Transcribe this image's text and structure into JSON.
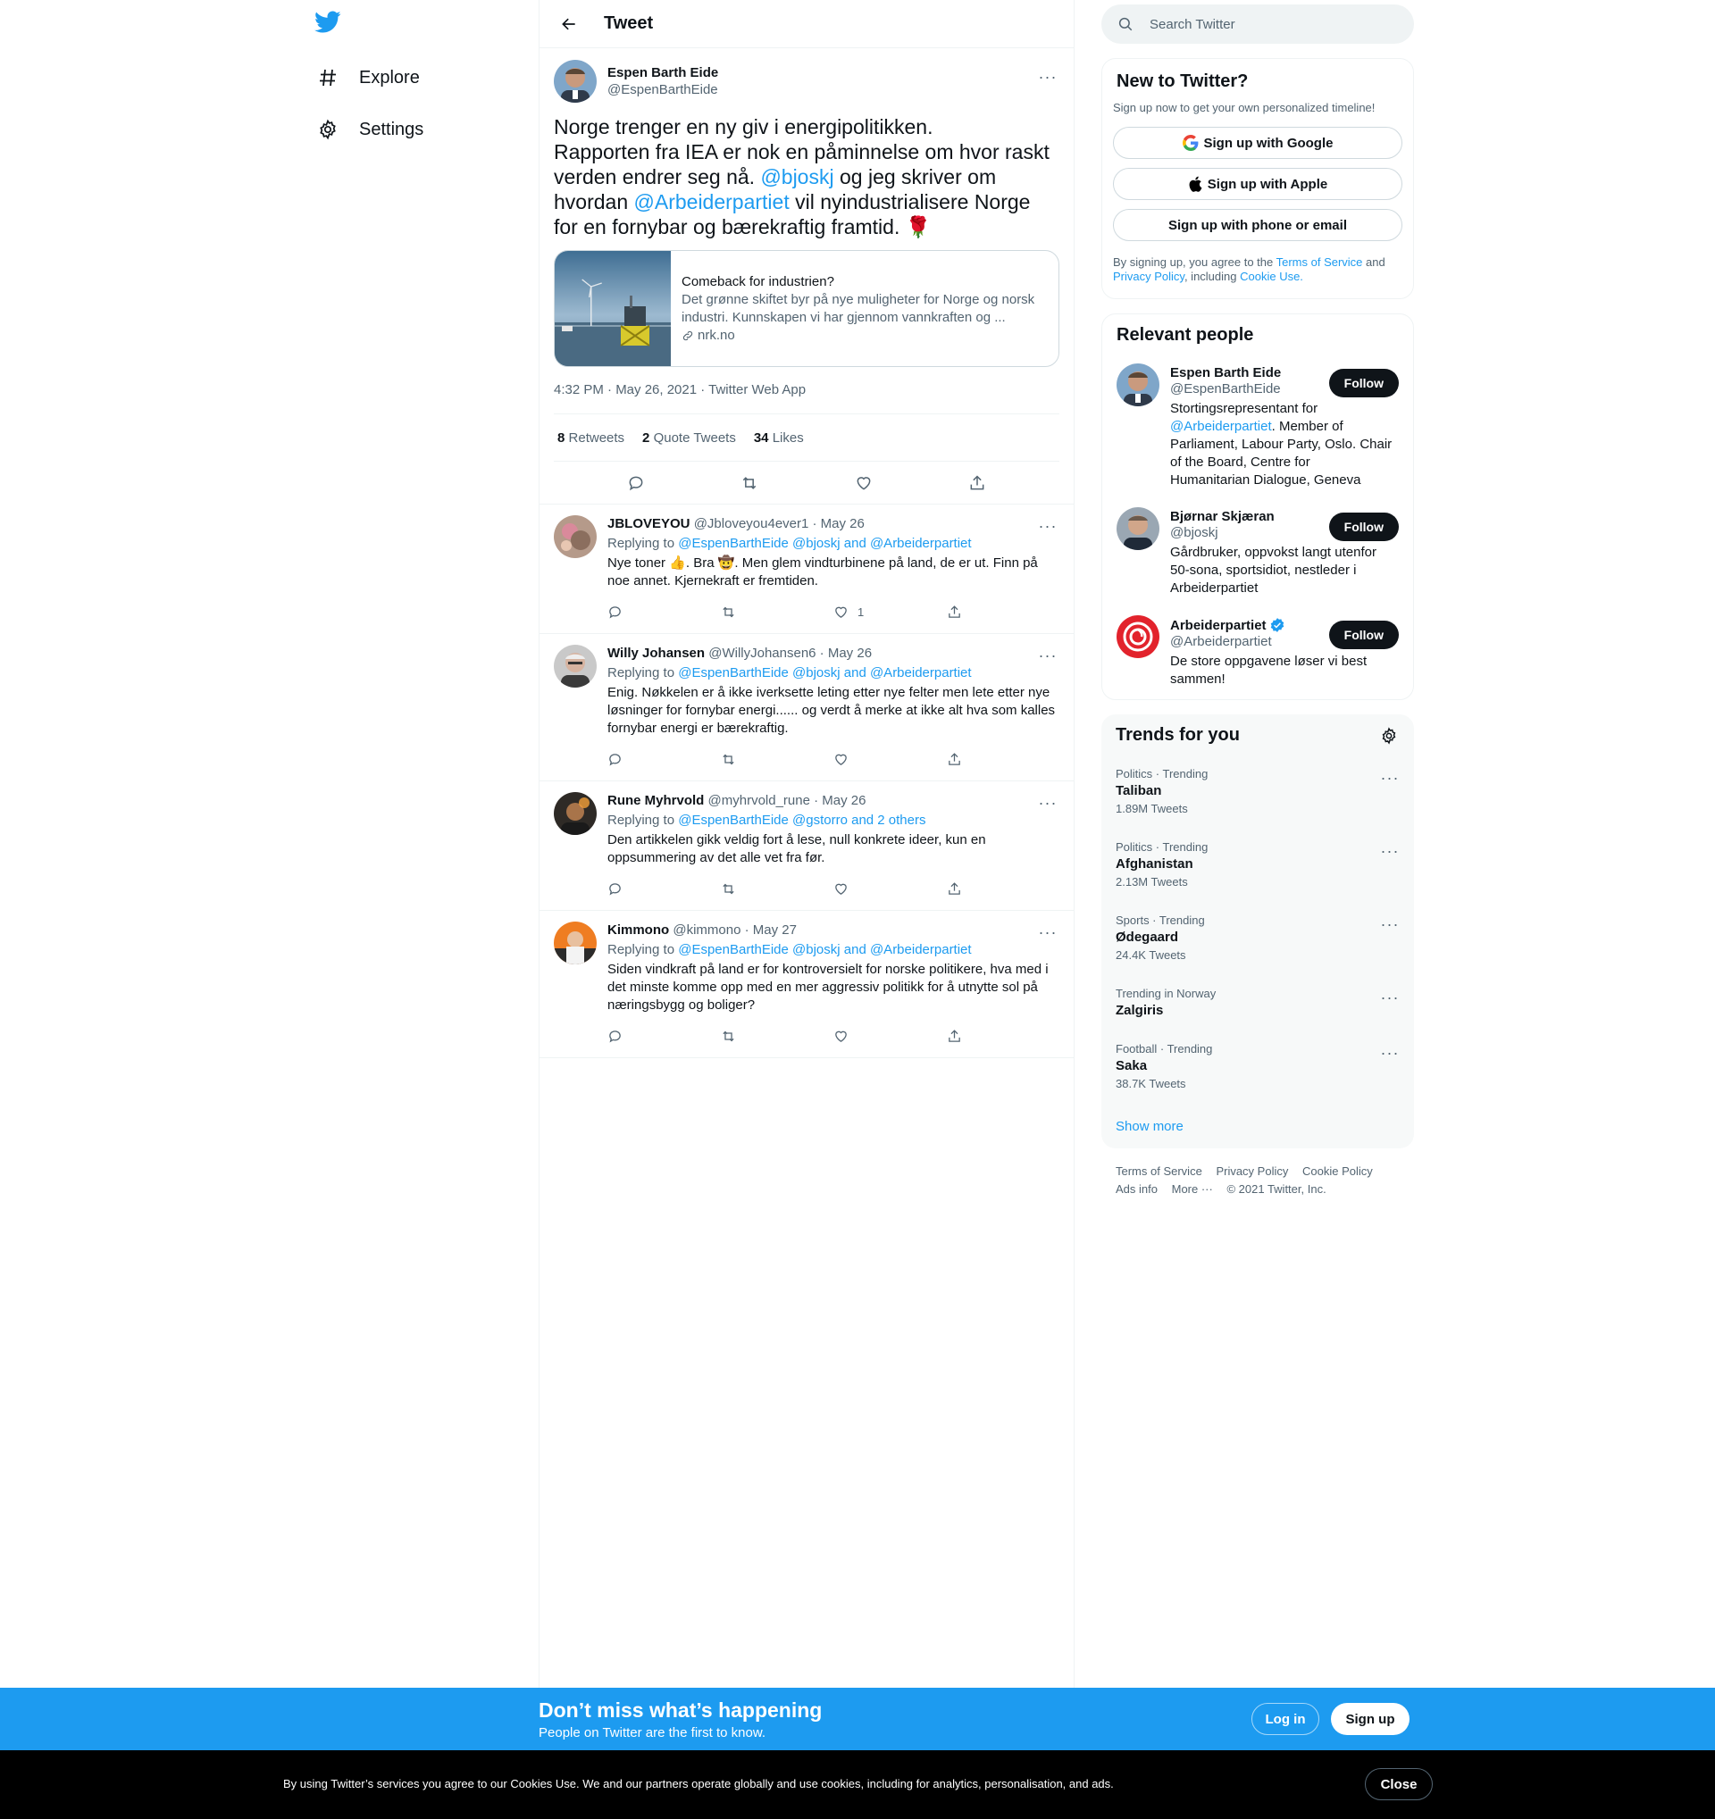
{
  "nav": {
    "items": [
      {
        "label": "Explore",
        "icon": "hashtag-icon"
      },
      {
        "label": "Settings",
        "icon": "gear-icon"
      }
    ]
  },
  "header": {
    "title": "Tweet"
  },
  "main_tweet": {
    "author_name": "Espen Barth Eide",
    "author_handle": "@EspenBarthEide",
    "text_1": "Norge trenger en ny giv i energipolitikken.\nRapporten fra IEA er nok en påminnelse om hvor raskt verden endrer seg nå. ",
    "mention_1": "@bjoskj",
    "text_2": " og jeg skriver om hvordan ",
    "mention_2": "@Arbeiderpartiet",
    "text_3": " vil nyindustrialisere Norge for en fornybar og bærekraftig framtid. ",
    "emoji": "🌹",
    "card": {
      "title": "Comeback for industrien?",
      "description": "Det grønne skiftet byr på nye muligheter for Norge og norsk industri. Kunnskapen vi har gjennom vannkraften og ...",
      "domain": "nrk.no"
    },
    "meta": "4:32 PM · May 26, 2021 · Twitter Web App",
    "stats": {
      "retweets_count": "8",
      "retweets_label": "Retweets",
      "quotes_count": "2",
      "quotes_label": "Quote Tweets",
      "likes_count": "34",
      "likes_label": "Likes"
    }
  },
  "replies": [
    {
      "name": "JBLOVEYOU",
      "handle_date": "@Jbloveyou4ever1 · May 26",
      "replying_prefix": "Replying to ",
      "replying_to": "@EspenBarthEide @bjoskj and @Arbeiderpartiet",
      "text": "Nye toner 👍. Bra 🤠. Men glem vindturbinene på land, de er ut. Finn på noe annet. Kjernekraft er fremtiden.",
      "like_count": "1"
    },
    {
      "name": "Willy Johansen",
      "handle_date": "@WillyJohansen6 · May 26",
      "replying_prefix": "Replying to ",
      "replying_to": "@EspenBarthEide @bjoskj and @Arbeiderpartiet",
      "text": "Enig. Nøkkelen er å ikke iverksette leting etter nye felter men lete etter nye løsninger for fornybar energi...... og verdt å merke at ikke alt hva som kalles fornybar energi er bærekraftig.",
      "like_count": ""
    },
    {
      "name": "Rune Myhrvold",
      "handle_date": "@myhrvold_rune · May 26",
      "replying_prefix": "Replying to ",
      "replying_to": "@EspenBarthEide @gstorro and 2 others",
      "text": "Den artikkelen gikk veldig fort å lese, null konkrete ideer, kun en oppsummering av det alle vet fra før.",
      "like_count": ""
    },
    {
      "name": "Kimmono",
      "handle_date": "@kimmono · May 27",
      "replying_prefix": "Replying to ",
      "replying_to": "@EspenBarthEide @bjoskj and @Arbeiderpartiet",
      "text": "Siden vindkraft på land er for kontroversielt for norske politikere, hva med i det minste komme opp med en mer aggressiv politikk for å utnytte sol på næringsbygg og boliger?",
      "like_count": ""
    }
  ],
  "search": {
    "placeholder": "Search Twitter"
  },
  "signup_panel": {
    "title": "New to Twitter?",
    "subtitle": "Sign up now to get your own personalized timeline!",
    "google": "Sign up with Google",
    "apple": "Sign up with Apple",
    "phone": "Sign up with phone or email",
    "terms_1": "By signing up, you agree to the ",
    "terms_link_1": "Terms of Service",
    "terms_2": " and ",
    "terms_link_2": "Privacy Policy",
    "terms_3": ", including ",
    "terms_link_3": "Cookie Use."
  },
  "relevant_people": {
    "title": "Relevant people",
    "follow_label": "Follow",
    "people": [
      {
        "name": "Espen Barth Eide",
        "handle": "@EspenBarthEide",
        "bio_1": "Stortingsrepresentant for ",
        "bio_link": "@Arbeiderpartiet",
        "bio_2": ". Member of Parliament, Labour Party, Oslo. Chair of the Board, Centre for Humanitarian Dialogue, Geneva"
      },
      {
        "name": "Bjørnar Skjæran",
        "handle": "@bjoskj",
        "bio_1": "Gårdbruker, oppvokst langt utenfor 50-sona, sportsidiot, nestleder i Arbeiderpartiet",
        "bio_link": "",
        "bio_2": ""
      },
      {
        "name": "Arbeiderpartiet",
        "handle": "@Arbeiderpartiet",
        "bio_1": "De store oppgavene løser vi best sammen!",
        "bio_link": "",
        "bio_2": ""
      }
    ]
  },
  "trends": {
    "title": "Trends for you",
    "items": [
      {
        "category": "Politics · Trending",
        "name": "Taliban",
        "count": "1.89M Tweets"
      },
      {
        "category": "Politics · Trending",
        "name": "Afghanistan",
        "count": "2.13M Tweets"
      },
      {
        "category": "Sports · Trending",
        "name": "Ødegaard",
        "count": "24.4K Tweets"
      },
      {
        "category": "Trending in Norway",
        "name": "Zalgiris",
        "count": ""
      },
      {
        "category": "Football · Trending",
        "name": "Saka",
        "count": "38.7K Tweets"
      }
    ],
    "show_more": "Show more"
  },
  "footer": {
    "terms": "Terms of Service",
    "privacy": "Privacy Policy",
    "cookie": "Cookie Policy",
    "ads": "Ads info",
    "more": "More ···",
    "copyright": "© 2021 Twitter, Inc."
  },
  "bottom_bar": {
    "title": "Don’t miss what’s happening",
    "subtitle": "People on Twitter are the first to know.",
    "login": "Log in",
    "signup": "Sign up"
  },
  "cookie_bar": {
    "text": "By using Twitter’s services you agree to our Cookies Use. We and our partners operate globally and use cookies, including for analytics, personalisation, and ads.",
    "close": "Close"
  },
  "colors": {
    "accent": "#1d9bf0",
    "text": "#0f1419",
    "muted": "#536471"
  },
  "more_glyph": "···"
}
